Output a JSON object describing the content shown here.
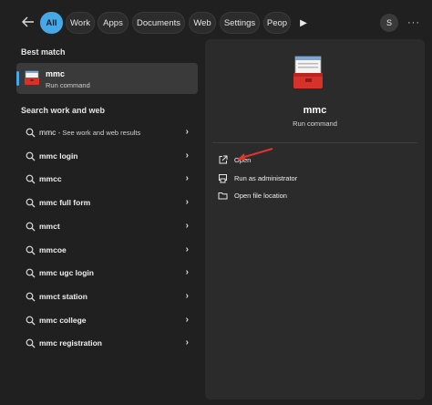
{
  "tabs": [
    {
      "label": "All",
      "active": true
    },
    {
      "label": "Work"
    },
    {
      "label": "Apps"
    },
    {
      "label": "Documents"
    },
    {
      "label": "Web"
    },
    {
      "label": "Settings"
    },
    {
      "label": "Peop"
    }
  ],
  "user_initial": "S",
  "best_match": {
    "heading": "Best match",
    "name": "mmc",
    "type": "Run command"
  },
  "search_web": {
    "heading": "Search work and web",
    "items": [
      {
        "query": "mmc",
        "hint": "- See work and web results"
      },
      {
        "query": "mmc login"
      },
      {
        "query": "mmcc"
      },
      {
        "query": "mmc full form"
      },
      {
        "query": "mmct"
      },
      {
        "query": "mmcoe"
      },
      {
        "query": "mmc ugc login"
      },
      {
        "query": "mmct station"
      },
      {
        "query": "mmc college"
      },
      {
        "query": "mmc registration"
      }
    ]
  },
  "detail": {
    "title": "mmc",
    "subtitle": "Run command",
    "actions": [
      {
        "label": "Open",
        "icon": "open-external-icon"
      },
      {
        "label": "Run as administrator",
        "icon": "shield-admin-icon"
      },
      {
        "label": "Open file location",
        "icon": "folder-icon"
      }
    ]
  },
  "colors": {
    "accent": "#47a8e8",
    "annotation_arrow": "#e0342e"
  }
}
